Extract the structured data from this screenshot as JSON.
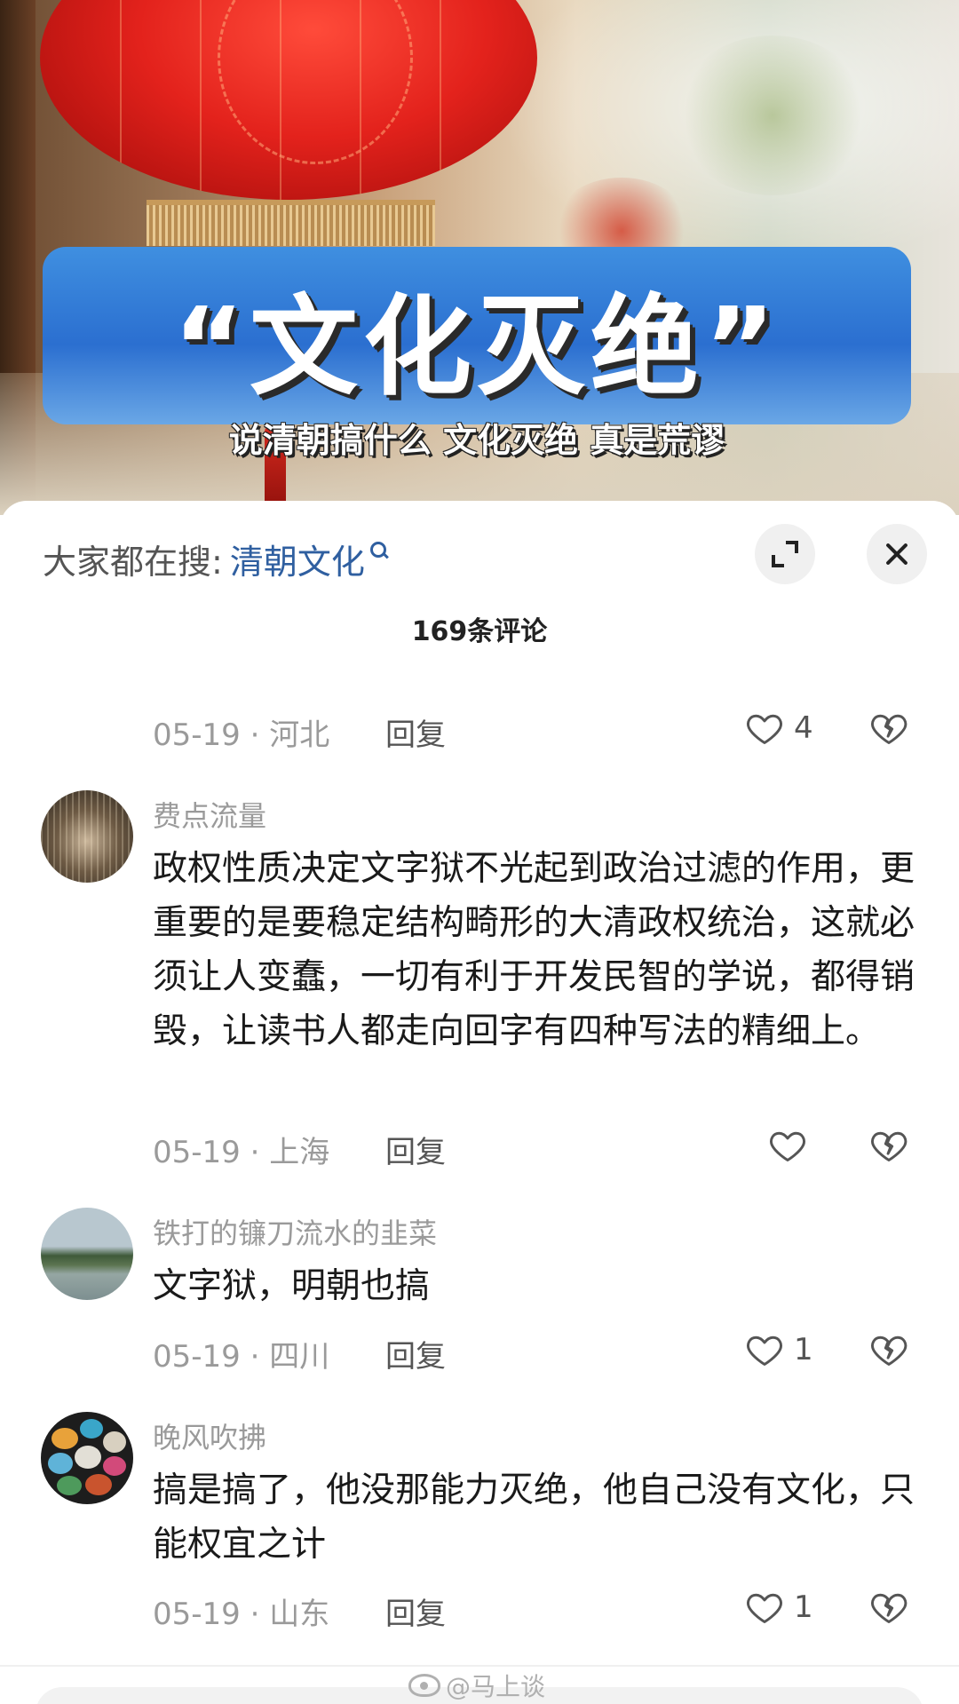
{
  "video": {
    "title": "“文化灭绝”",
    "subtitle": "说清朝搞什么 文化灭绝 真是荒谬"
  },
  "search": {
    "prefix": "大家都在搜:",
    "term": "清朝文化"
  },
  "comments_header": {
    "count_label": "169条评论"
  },
  "comments": [
    {
      "username": "",
      "text": "",
      "date_location": "05-19 · 河北",
      "reply_label": "回复",
      "likes": "4"
    },
    {
      "username": "费点流量",
      "text": "政权性质决定文字狱不光起到政治过滤的作用，更重要的是要稳定结构畸形的大清政权统治，这就必须让人变蠢，一切有利于开发民智的学说，都得销毁，让读书人都走向回字有四种写法的精细上。",
      "date_location": "05-19 · 上海",
      "reply_label": "回复",
      "likes": ""
    },
    {
      "username": "铁打的镰刀流水的韭菜",
      "text": "文字狱，明朝也搞",
      "date_location": "05-19 · 四川",
      "reply_label": "回复",
      "likes": "1"
    },
    {
      "username": "晚风吹拂",
      "text": "搞是搞了，他没那能力灭绝，他自己没有文化，只能权宜之计",
      "date_location": "05-19 · 山东",
      "reply_label": "回复",
      "likes": "1"
    }
  ],
  "watermark": {
    "text": "@马上谈"
  },
  "icons": {
    "search": "search-icon",
    "expand": "expand-icon",
    "close": "close-icon",
    "like": "heart-icon",
    "dislike": "broken-heart-icon",
    "weibo": "weibo-icon"
  },
  "colors": {
    "search_term": "#2f5fa0",
    "meta_gray": "#9a9a9a",
    "text": "#1a1a1a",
    "title_card": "#2b6fd0",
    "lantern_red": "#e3221c"
  }
}
